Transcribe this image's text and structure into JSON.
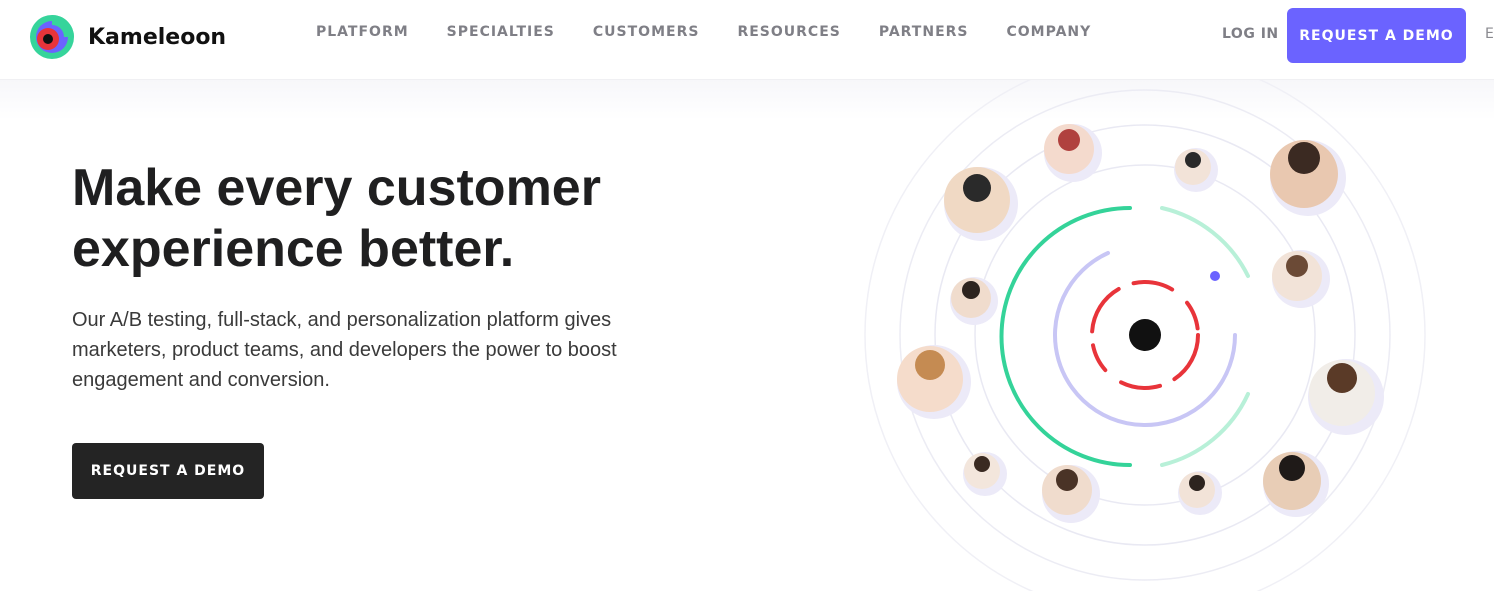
{
  "header": {
    "brand": "Kameleoon",
    "nav": [
      "PLATFORM",
      "SPECIALTIES",
      "CUSTOMERS",
      "RESOURCES",
      "PARTNERS",
      "COMPANY"
    ],
    "login": "LOG IN",
    "demo_button": "REQUEST A DEMO",
    "lang": "E"
  },
  "hero": {
    "title_line1": "Make every customer",
    "title_line2": "experience better.",
    "subtitle_line1": "Our A/B testing, full-stack, and personalization platform gives",
    "subtitle_line2": "marketers, product teams, and developers the power to boost",
    "subtitle_line3": "engagement and conversion.",
    "cta": "REQUEST A DEMO"
  },
  "colors": {
    "accent": "#6b63ff",
    "logo_green": "#36d49b",
    "logo_red": "#e8343a",
    "orbit_lavender": "#c8c6f5",
    "orbit_green": "#34d399",
    "cta_dark": "#242424"
  },
  "illustration": {
    "icon": "avatar-orbit-icon"
  }
}
